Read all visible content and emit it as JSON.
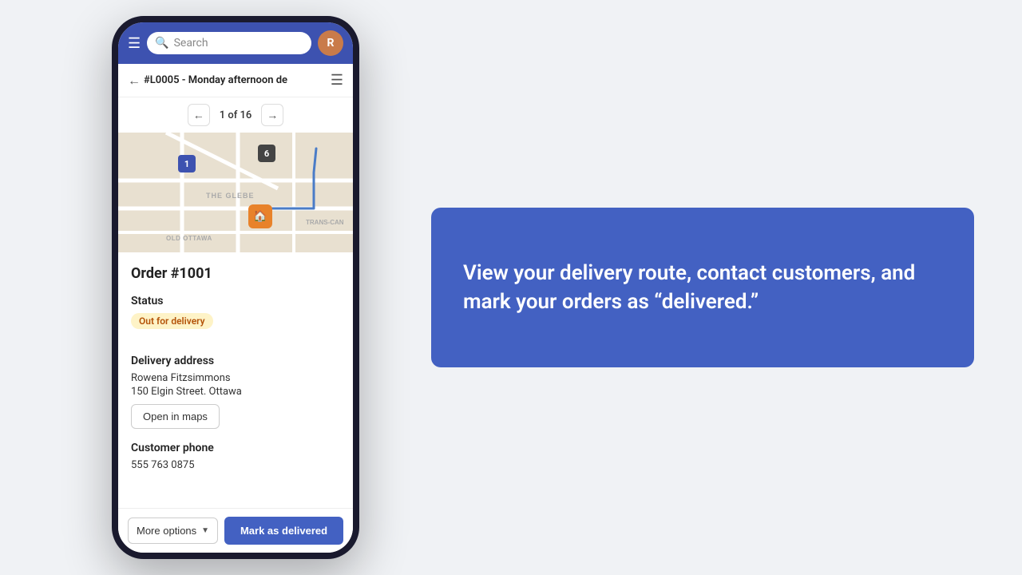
{
  "header": {
    "menu_label": "☰",
    "search_placeholder": "Search",
    "avatar_initials": "R"
  },
  "sub_header": {
    "route_id": "#L0005 - Monday afternoon de",
    "page_current": "1",
    "page_total": "16",
    "page_display": "1 of 16"
  },
  "order": {
    "title": "Order #1001",
    "status_label": "Status",
    "status_value": "Out for delivery",
    "delivery_address_label": "Delivery address",
    "customer_name": "Rowena Fitzsimmons",
    "customer_address": "150 Elgin Street. Ottawa",
    "open_maps_label": "Open in maps",
    "customer_phone_label": "Customer phone",
    "customer_phone": "555 763 0875"
  },
  "bottom_bar": {
    "more_options_label": "More options",
    "mark_delivered_label": "Mark as delivered"
  },
  "info_card": {
    "text": "View your delivery route, contact customers, and mark your orders as “delivered.”"
  },
  "map": {
    "label_glebe": "THE GLEBE",
    "label_ottawa": "OLD OTTAWA",
    "pin1_label": "1",
    "pin6_label": "6"
  },
  "colors": {
    "primary": "#4361c2",
    "header_bg": "#3d52b0",
    "status_bg": "#fef3c7",
    "status_text": "#b45309",
    "card_bg": "#4361c2"
  }
}
